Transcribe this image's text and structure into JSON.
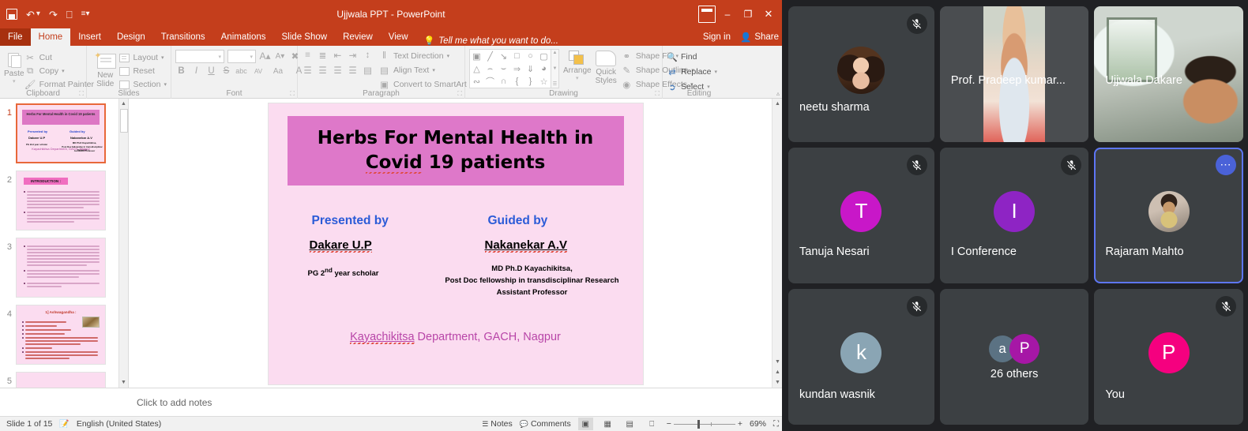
{
  "app": {
    "window_title": "Ujjwala PPT - PowerPoint",
    "quick_access": [
      "save-icon",
      "undo-icon",
      "redo-icon",
      "start-presentation-icon",
      "customize-qat-icon"
    ],
    "window_buttons": {
      "ribbon_display": "ribbon-display-options",
      "minimize": "–",
      "restore": "❐",
      "close": "✕"
    }
  },
  "tabs": [
    {
      "label": "File",
      "active": false
    },
    {
      "label": "Home",
      "active": true
    },
    {
      "label": "Insert",
      "active": false
    },
    {
      "label": "Design",
      "active": false
    },
    {
      "label": "Transitions",
      "active": false
    },
    {
      "label": "Animations",
      "active": false
    },
    {
      "label": "Slide Show",
      "active": false
    },
    {
      "label": "Review",
      "active": false
    },
    {
      "label": "View",
      "active": false
    }
  ],
  "tell_me": "Tell me what you want to do...",
  "account": {
    "sign_in": "Sign in",
    "share": "Share"
  },
  "ribbon": {
    "clipboard": {
      "group_label": "Clipboard",
      "paste": "Paste",
      "cut": "Cut",
      "copy": "Copy",
      "format_painter": "Format Painter"
    },
    "slides": {
      "group_label": "Slides",
      "new_slide": "New Slide",
      "layout": "Layout",
      "reset": "Reset",
      "section": "Section"
    },
    "font": {
      "group_label": "Font",
      "font_name": "",
      "font_size": "",
      "grow": "A",
      "shrink": "A",
      "clear_formatting": "clear-formatting-icon",
      "bold": "B",
      "italic": "I",
      "underline": "U",
      "strikethrough": "S",
      "text_shadow": "abc",
      "char_spacing": "AV",
      "change_case": "Aa",
      "font_color": "A"
    },
    "paragraph": {
      "group_label": "Paragraph",
      "text_direction": "Text Direction",
      "align_text": "Align Text",
      "convert_to_smartart": "Convert to SmartArt"
    },
    "drawing": {
      "group_label": "Drawing",
      "arrange": "Arrange",
      "quick_styles": "Quick Styles",
      "shape_fill": "Shape Fill",
      "shape_outline": "Shape Outline",
      "shape_effects": "Shape Effects"
    },
    "editing": {
      "group_label": "Editing",
      "find": "Find",
      "replace": "Replace",
      "select": "Select"
    }
  },
  "thumbnails": [
    {
      "number": "1",
      "selected": true
    },
    {
      "number": "2",
      "selected": false
    },
    {
      "number": "3",
      "selected": false
    },
    {
      "number": "4",
      "selected": false
    },
    {
      "number": "5",
      "selected": false
    }
  ],
  "thumbnail_text": {
    "slide1_title": "Herbs For Mental Health in  Covid 19 patients",
    "slide1_presented": "Presented by",
    "slide1_guided": "Guided by",
    "slide1_name1": "Dakare U.P",
    "slide1_name2": "Nakanekar A.V",
    "slide1_sub1": "PG 2nd year scholar",
    "slide1_sub2a": "MD Ph.D Kayachikitsa,",
    "slide1_sub2b": "Post Doc fellowship in transdisciplinar Research",
    "slide1_sub2c": "Assistant Professor",
    "slide1_dept": "Kayachikitsa Department, GACH, Nagpur",
    "slide2_heading": "INTRODUCTION :",
    "slide4_heading": "1] Ashwagandha  :"
  },
  "slide": {
    "title": "Herbs For Mental Health in Covid 19 patients",
    "title_underlined_word": "Covid",
    "presented_by": "Presented by",
    "guided_by": "Guided by",
    "presenter_name": "Dakare U.P",
    "guide_name": "Nakanekar A.V",
    "presenter_sub": "PG 2nd year scholar",
    "presenter_sub_sup": "nd",
    "guide_sub_line1": "MD Ph.D Kayachikitsa,",
    "guide_sub_line2": "Post Doc fellowship in transdisciplinar Research",
    "guide_sub_line3": "Assistant Professor",
    "department": "Kayachikitsa Department, GACH, Nagpur",
    "department_underlined": "Kayachikitsa",
    "colors": {
      "slide_bg": "#fbdcf0",
      "title_bg": "#de78c9",
      "heading_blue": "#2b5bd7",
      "department_pink": "#b845a8"
    }
  },
  "notes_placeholder": "Click to add notes",
  "status_bar": {
    "slide_counter": "Slide 1 of 15",
    "language": "English (United States)",
    "notes_button": "Notes",
    "comments_button": "Comments",
    "views": [
      "normal-view",
      "slide-sorter-view",
      "reading-view",
      "slide-show-view"
    ],
    "zoom_out": "−",
    "zoom_in": "+",
    "zoom_level": "69%",
    "fit_to_window": "fit-slide-to-window"
  },
  "meet": {
    "participants": [
      {
        "name": "neetu sharma",
        "type": "avatar-photo",
        "muted": true,
        "selected": false,
        "avatar_kind": "ph-neetu"
      },
      {
        "name": "Prof. Pradeep kumar...",
        "type": "video",
        "muted": false,
        "selected": false
      },
      {
        "name": "Ujjwala Dakare",
        "type": "video",
        "muted": false,
        "selected": false
      },
      {
        "name": "Tanuja Nesari",
        "type": "initial",
        "initial": "T",
        "color": "#c817c8",
        "muted": true,
        "selected": false
      },
      {
        "name": "I Conference",
        "type": "initial",
        "initial": "I",
        "color": "#8e24c4",
        "muted": true,
        "selected": false
      },
      {
        "name": "Rajaram Mahto",
        "type": "avatar-photo",
        "muted": false,
        "selected": true,
        "more_menu": true,
        "avatar_kind": "ph-rajaram"
      },
      {
        "name": "kundan wasnik",
        "type": "initial",
        "initial": "k",
        "color": "#8aa5b4",
        "muted": true,
        "selected": false
      },
      {
        "name": "26 others",
        "type": "multi",
        "initials": [
          "a",
          "P"
        ],
        "muted": false,
        "selected": false
      },
      {
        "name": "You",
        "type": "initial",
        "initial": "P",
        "color": "#f5007f",
        "muted": true,
        "selected": false
      }
    ],
    "others_count_label": "26 others",
    "selected_border_color": "#5d76f5"
  }
}
